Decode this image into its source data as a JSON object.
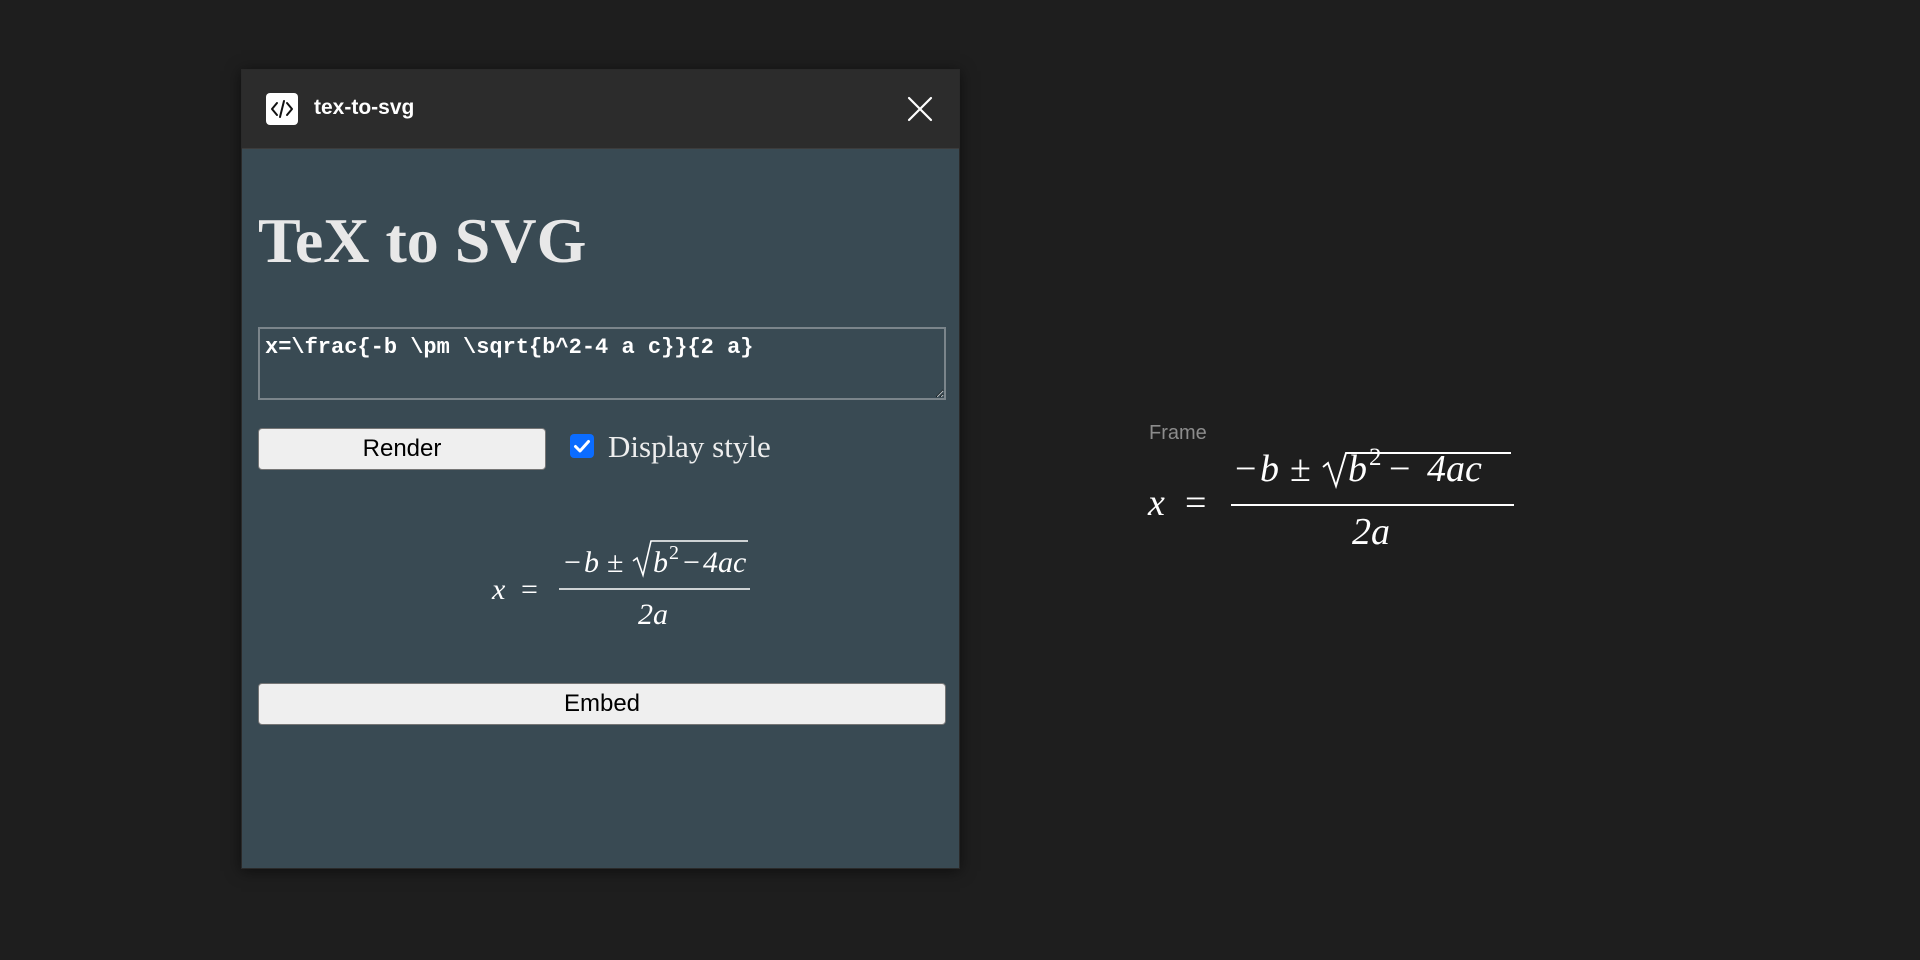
{
  "window": {
    "title": "tex-to-svg",
    "icon": "code-icon",
    "close_icon": "close-icon"
  },
  "plugin": {
    "heading": "TeX to SVG",
    "tex_input_value": "x=\\frac{-b \\pm \\sqrt{b^2-4 a c}}{2 a}",
    "render_label": "Render",
    "display_style_label": "Display style",
    "display_style_checked": true,
    "embed_label": "Embed",
    "preview": {
      "lhs": "x",
      "equals": "=",
      "numerator_minus": "−",
      "numerator_b": "b",
      "plus_minus": "±",
      "radicand_b": "b",
      "exponent": "2",
      "radicand_minus": "−",
      "radicand_rest": "4ac",
      "denominator": "2a"
    }
  },
  "canvas": {
    "frame_label": "Frame",
    "equation": {
      "lhs": "x",
      "equals": "=",
      "numerator_minus": "−",
      "numerator_b": "b",
      "plus_minus": "±",
      "radicand_b": "b",
      "exponent": "2",
      "radicand_minus": "−",
      "radicand_rest": "4ac",
      "denominator": "2a"
    }
  },
  "colors": {
    "app_background": "#1e1e1e",
    "title_bar": "#2c2c2c",
    "plugin_background": "#394a53",
    "checkbox_accent": "#0b6cff",
    "button_background": "#efefef"
  }
}
